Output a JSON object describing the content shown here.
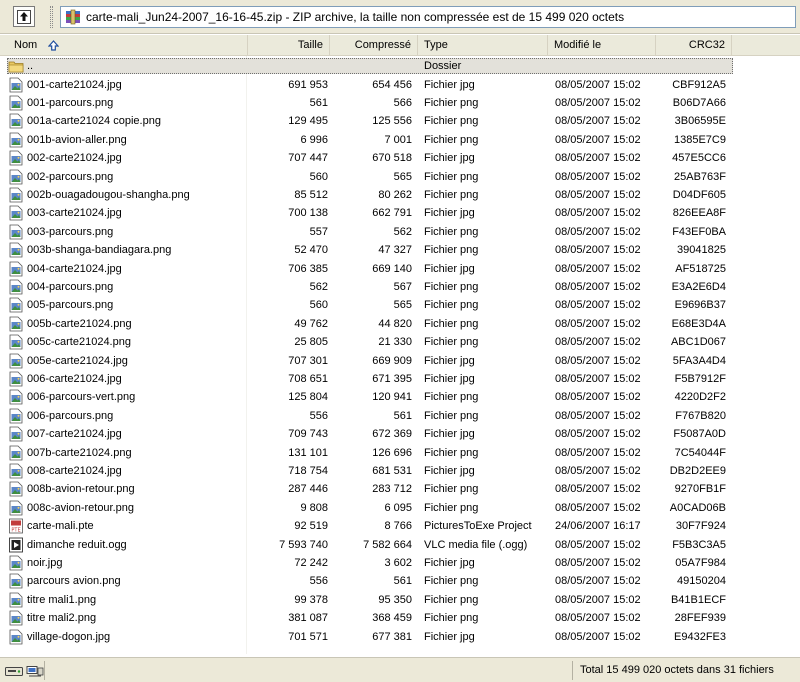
{
  "path_bar": {
    "path": "carte-mali_Jun24-2007_16-16-45.zip - ZIP archive, la taille non compressée est de 15 499 020 octets"
  },
  "columns": {
    "name": "Nom",
    "size": "Taille",
    "compressed": "Compressé",
    "type": "Type",
    "modified": "Modifié le",
    "crc": "CRC32"
  },
  "parent_row": {
    "name": "..",
    "type": "Dossier"
  },
  "files": [
    {
      "name": "001-carte21024.jpg",
      "size": "691 953",
      "compressed": "654 456",
      "type": "Fichier jpg",
      "modified": "08/05/2007 15:02",
      "crc": "CBF912A5",
      "icon": "image-file-icon"
    },
    {
      "name": "001-parcours.png",
      "size": "561",
      "compressed": "566",
      "type": "Fichier png",
      "modified": "08/05/2007 15:02",
      "crc": "B06D7A66",
      "icon": "image-file-icon"
    },
    {
      "name": "001a-carte21024 copie.png",
      "size": "129 495",
      "compressed": "125 556",
      "type": "Fichier png",
      "modified": "08/05/2007 15:02",
      "crc": "3B06595E",
      "icon": "image-file-icon"
    },
    {
      "name": "001b-avion-aller.png",
      "size": "6 996",
      "compressed": "7 001",
      "type": "Fichier png",
      "modified": "08/05/2007 15:02",
      "crc": "1385E7C9",
      "icon": "image-file-icon"
    },
    {
      "name": "002-carte21024.jpg",
      "size": "707 447",
      "compressed": "670 518",
      "type": "Fichier jpg",
      "modified": "08/05/2007 15:02",
      "crc": "457E5CC6",
      "icon": "image-file-icon"
    },
    {
      "name": "002-parcours.png",
      "size": "560",
      "compressed": "565",
      "type": "Fichier png",
      "modified": "08/05/2007 15:02",
      "crc": "25AB763F",
      "icon": "image-file-icon"
    },
    {
      "name": "002b-ouagadougou-shangha.png",
      "size": "85 512",
      "compressed": "80 262",
      "type": "Fichier png",
      "modified": "08/05/2007 15:02",
      "crc": "D04DF605",
      "icon": "image-file-icon"
    },
    {
      "name": "003-carte21024.jpg",
      "size": "700 138",
      "compressed": "662 791",
      "type": "Fichier jpg",
      "modified": "08/05/2007 15:02",
      "crc": "826EEA8F",
      "icon": "image-file-icon"
    },
    {
      "name": "003-parcours.png",
      "size": "557",
      "compressed": "562",
      "type": "Fichier png",
      "modified": "08/05/2007 15:02",
      "crc": "F43EF0BA",
      "icon": "image-file-icon"
    },
    {
      "name": "003b-shanga-bandiagara.png",
      "size": "52 470",
      "compressed": "47 327",
      "type": "Fichier png",
      "modified": "08/05/2007 15:02",
      "crc": "39041825",
      "icon": "image-file-icon"
    },
    {
      "name": "004-carte21024.jpg",
      "size": "706 385",
      "compressed": "669 140",
      "type": "Fichier jpg",
      "modified": "08/05/2007 15:02",
      "crc": "AF518725",
      "icon": "image-file-icon"
    },
    {
      "name": "004-parcours.png",
      "size": "562",
      "compressed": "567",
      "type": "Fichier png",
      "modified": "08/05/2007 15:02",
      "crc": "E3A2E6D4",
      "icon": "image-file-icon"
    },
    {
      "name": "005-parcours.png",
      "size": "560",
      "compressed": "565",
      "type": "Fichier png",
      "modified": "08/05/2007 15:02",
      "crc": "E9696B37",
      "icon": "image-file-icon"
    },
    {
      "name": "005b-carte21024.png",
      "size": "49 762",
      "compressed": "44 820",
      "type": "Fichier png",
      "modified": "08/05/2007 15:02",
      "crc": "E68E3D4A",
      "icon": "image-file-icon"
    },
    {
      "name": "005c-carte21024.png",
      "size": "25 805",
      "compressed": "21 330",
      "type": "Fichier png",
      "modified": "08/05/2007 15:02",
      "crc": "ABC1D067",
      "icon": "image-file-icon"
    },
    {
      "name": "005e-carte21024.jpg",
      "size": "707 301",
      "compressed": "669 909",
      "type": "Fichier jpg",
      "modified": "08/05/2007 15:02",
      "crc": "5FA3A4D4",
      "icon": "image-file-icon"
    },
    {
      "name": "006-carte21024.jpg",
      "size": "708 651",
      "compressed": "671 395",
      "type": "Fichier jpg",
      "modified": "08/05/2007 15:02",
      "crc": "F5B7912F",
      "icon": "image-file-icon"
    },
    {
      "name": "006-parcours-vert.png",
      "size": "125 804",
      "compressed": "120 941",
      "type": "Fichier png",
      "modified": "08/05/2007 15:02",
      "crc": "4220D2F2",
      "icon": "image-file-icon"
    },
    {
      "name": "006-parcours.png",
      "size": "556",
      "compressed": "561",
      "type": "Fichier png",
      "modified": "08/05/2007 15:02",
      "crc": "F767B820",
      "icon": "image-file-icon"
    },
    {
      "name": "007-carte21024.jpg",
      "size": "709 743",
      "compressed": "672 369",
      "type": "Fichier jpg",
      "modified": "08/05/2007 15:02",
      "crc": "F5087A0D",
      "icon": "image-file-icon"
    },
    {
      "name": "007b-carte21024.png",
      "size": "131 101",
      "compressed": "126 696",
      "type": "Fichier png",
      "modified": "08/05/2007 15:02",
      "crc": "7C54044F",
      "icon": "image-file-icon"
    },
    {
      "name": "008-carte21024.jpg",
      "size": "718 754",
      "compressed": "681 531",
      "type": "Fichier jpg",
      "modified": "08/05/2007 15:02",
      "crc": "DB2D2EE9",
      "icon": "image-file-icon"
    },
    {
      "name": "008b-avion-retour.png",
      "size": "287 446",
      "compressed": "283 712",
      "type": "Fichier png",
      "modified": "08/05/2007 15:02",
      "crc": "9270FB1F",
      "icon": "image-file-icon"
    },
    {
      "name": "008c-avion-retour.png",
      "size": "9 808",
      "compressed": "6 095",
      "type": "Fichier png",
      "modified": "08/05/2007 15:02",
      "crc": "A0CAD06B",
      "icon": "image-file-icon"
    },
    {
      "name": "carte-mali.pte",
      "size": "92 519",
      "compressed": "8 766",
      "type": "PicturesToExe Project",
      "modified": "24/06/2007 16:17",
      "crc": "30F7F924",
      "icon": "pte-file-icon"
    },
    {
      "name": "dimanche reduit.ogg",
      "size": "7 593 740",
      "compressed": "7 582 664",
      "type": "VLC media file (.ogg)",
      "modified": "08/05/2007 15:02",
      "crc": "F5B3C3A5",
      "icon": "media-file-icon"
    },
    {
      "name": "noir.jpg",
      "size": "72 242",
      "compressed": "3 602",
      "type": "Fichier jpg",
      "modified": "08/05/2007 15:02",
      "crc": "05A7F984",
      "icon": "image-file-icon"
    },
    {
      "name": "parcours avion.png",
      "size": "556",
      "compressed": "561",
      "type": "Fichier png",
      "modified": "08/05/2007 15:02",
      "crc": "49150204",
      "icon": "image-file-icon"
    },
    {
      "name": "titre mali1.png",
      "size": "99 378",
      "compressed": "95 350",
      "type": "Fichier png",
      "modified": "08/05/2007 15:02",
      "crc": "B41B1ECF",
      "icon": "image-file-icon"
    },
    {
      "name": "titre mali2.png",
      "size": "381 087",
      "compressed": "368 459",
      "type": "Fichier png",
      "modified": "08/05/2007 15:02",
      "crc": "28FEF939",
      "icon": "image-file-icon"
    },
    {
      "name": "village-dogon.jpg",
      "size": "701 571",
      "compressed": "677 381",
      "type": "Fichier jpg",
      "modified": "08/05/2007 15:02",
      "crc": "E9432FE3",
      "icon": "image-file-icon"
    }
  ],
  "status": {
    "total": "Total 15 499 020 octets dans 31 fichiers"
  },
  "colors": {
    "chrome": "#ece9d8",
    "header": "#ebeadb",
    "selection": "#e3e1da",
    "folder": "#e8c862"
  }
}
